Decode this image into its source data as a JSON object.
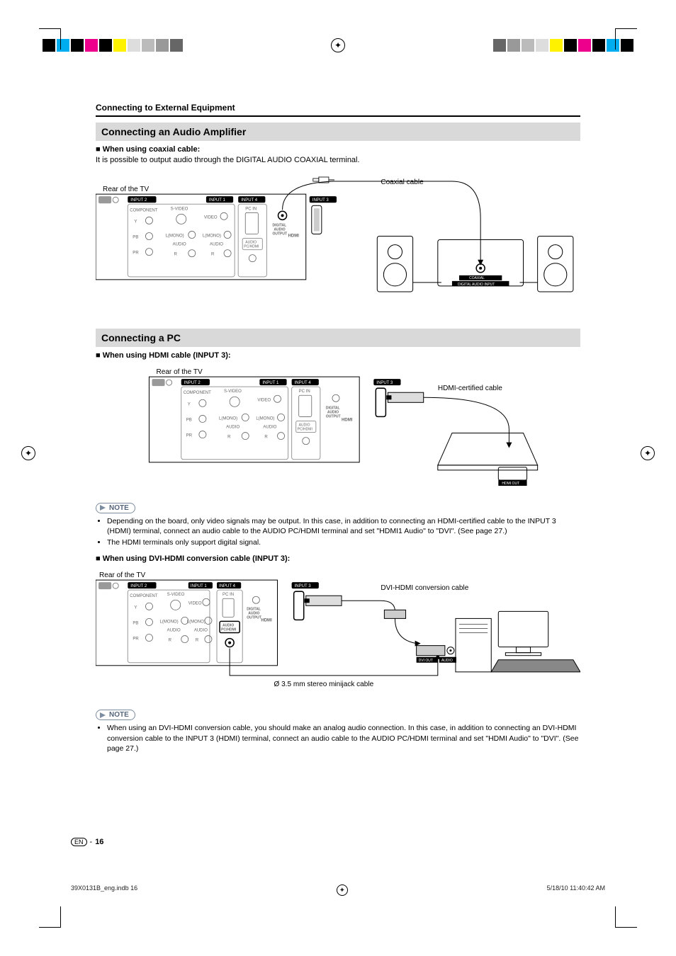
{
  "breadcrumb": "Connecting to External Equipment",
  "section1": {
    "title": "Connecting an Audio Amplifier",
    "sub": "When using coaxial cable:",
    "desc": "It is possible to output audio through the DIGITAL AUDIO COAXIAL terminal.",
    "fig": {
      "rear_label": "Rear of the TV",
      "cable_label": "Coaxial cable",
      "amp_label_1": "COAXIAL",
      "amp_label_2": "DIGITAL AUDIO INPUT"
    }
  },
  "section2": {
    "title": "Connecting a PC",
    "sub1": "When using HDMI cable (INPUT 3):",
    "fig1": {
      "rear_label": "Rear of the TV",
      "cable_label": "HDMI-certified cable",
      "device_port": "HDMI OUT"
    },
    "note1_items": [
      "Depending on the board, only video signals may be output. In this case, in addition to connecting an HDMI-certified cable to the INPUT 3 (HDMI) terminal, connect an audio cable to the AUDIO PC/HDMI terminal and set \"HDMI1 Audio\" to \"DVI\". (See page 27.)",
      "The HDMI terminals only support digital signal."
    ],
    "sub2": "When using DVI-HDMI conversion cable (INPUT 3):",
    "fig2": {
      "rear_label": "Rear of the TV",
      "cable_label": "DVI-HDMI conversion cable",
      "audio_cable": "Ø 3.5 mm stereo minijack cable",
      "device_port1": "DVI OUT",
      "device_port2": "AUDIO"
    },
    "note2_items": [
      "When using an DVI-HDMI conversion cable, you should make an analog audio connection. In this case, in addition to connecting an DVI-HDMI conversion cable to the INPUT 3 (HDMI) terminal, connect an audio cable to the AUDIO PC/HDMI terminal and set \"HDMI Audio\" to \"DVI\". (See page 27.)"
    ]
  },
  "note_label": "NOTE",
  "page_lang": "EN",
  "page_sep": "-",
  "page_num": "16",
  "footer_file": "39X0131B_eng.indb   16",
  "footer_date": "5/18/10   11:40:42 AM",
  "panel": {
    "input1": "INPUT 1",
    "input2": "INPUT 2",
    "input3": "INPUT 3",
    "input4": "INPUT 4",
    "component": "COMPONENT",
    "svideo": "S-VIDEO",
    "video": "VIDEO",
    "pcin": "PC IN",
    "y": "Y",
    "pb": "PB",
    "pr": "PR",
    "lmono": "L(MONO)",
    "audio": "AUDIO",
    "r": "R",
    "audio_pchdmi_1": "AUDIO",
    "audio_pchdmi_2": "PC/HDMI",
    "digital_audio_output_1": "DIGITAL",
    "digital_audio_output_2": "AUDIO",
    "digital_audio_output_3": "OUTPUT",
    "hdmi": "HDMI"
  }
}
